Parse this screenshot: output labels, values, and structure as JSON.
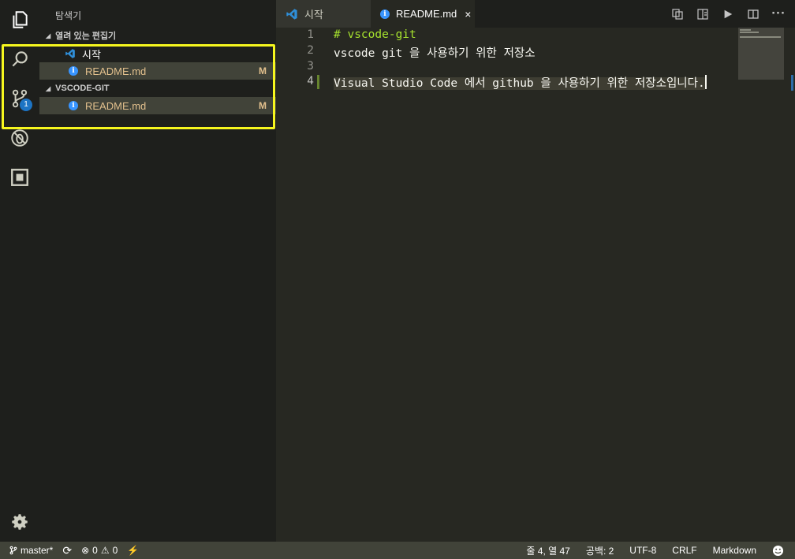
{
  "sidebar": {
    "title": "탐색기",
    "open_editors": {
      "label": "열려 있는 편집기",
      "items": [
        {
          "label": "시작",
          "modified": ""
        },
        {
          "label": "README.md",
          "modified": "M"
        }
      ]
    },
    "workspace": {
      "label": "VSCODE-GIT",
      "items": [
        {
          "label": "README.md",
          "modified": "M"
        }
      ]
    }
  },
  "activity": {
    "scm_badge": "1",
    "items": [
      "explorer-icon",
      "search-icon",
      "source-control-icon",
      "debug-icon",
      "extensions-icon"
    ],
    "settings": "gear-icon"
  },
  "tabs": [
    {
      "label": "시작",
      "active": false
    },
    {
      "label": "README.md",
      "active": true,
      "close": "×"
    }
  ],
  "editor": {
    "line_numbers": [
      "1",
      "2",
      "3",
      "4"
    ],
    "lines": [
      "# vscode-git",
      "vscode git 을 사용하기 위한 저장소",
      "",
      "Visual Studio Code 에서 github 을 사용하기 위한 저장소입니다."
    ]
  },
  "statusbar": {
    "branch": "master*",
    "errors": "0",
    "warnings": "0",
    "position": "줄 4, 열 47",
    "indent": "공백: 2",
    "encoding": "UTF-8",
    "eol": "CRLF",
    "language": "Markdown"
  },
  "colors": {
    "accent": "#1d74c4",
    "highlight_box": "#f6f61e",
    "modified": "#e2c08d",
    "heading": "#a6e22e"
  }
}
